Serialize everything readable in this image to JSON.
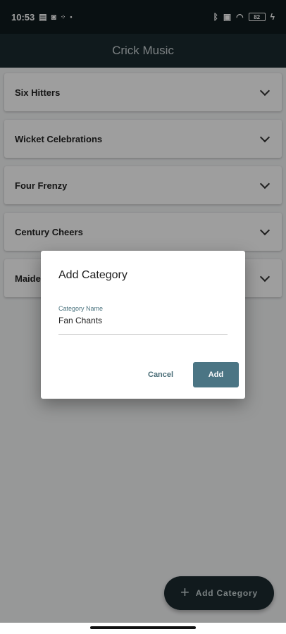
{
  "status_bar": {
    "time": "10:53",
    "battery": "82",
    "left_icons": [
      "storage-icon",
      "app-icon",
      "data-speed-icon",
      "dot-icon"
    ],
    "right_icons": [
      "bluetooth-icon",
      "volte-icon",
      "wifi-icon",
      "battery-icon",
      "charging-icon"
    ]
  },
  "app_bar": {
    "title": "Crick Music"
  },
  "categories": [
    {
      "label": "Six Hitters"
    },
    {
      "label": "Wicket Celebrations"
    },
    {
      "label": "Four Frenzy"
    },
    {
      "label": "Century Cheers"
    },
    {
      "label": "Maide"
    }
  ],
  "fab": {
    "label": "Add Category"
  },
  "dialog": {
    "title": "Add Category",
    "field_label": "Category Name",
    "field_value": "Fan Chants",
    "cancel_label": "Cancel",
    "add_label": "Add"
  }
}
